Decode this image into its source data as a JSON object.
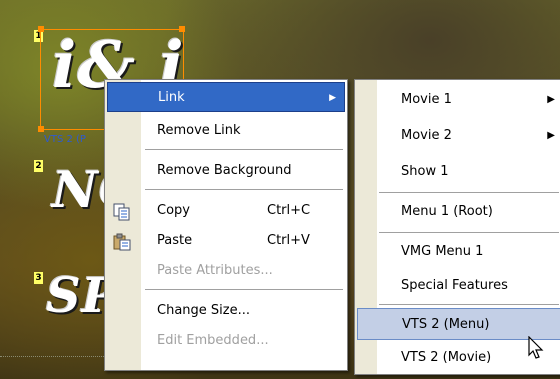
{
  "canvas": {
    "items": [
      {
        "num": "1",
        "text": "i& i"
      },
      {
        "num": "2",
        "text": "NO"
      },
      {
        "num": "3",
        "text": "SP"
      }
    ],
    "selected_label": "VTS 2 (P"
  },
  "context_menu": {
    "items": [
      {
        "label": "Link",
        "has_submenu": true,
        "state": "highlighted"
      },
      {
        "label": "Remove Link",
        "state": "enabled"
      },
      {
        "label": "Remove Background",
        "state": "enabled"
      },
      {
        "label": "Copy",
        "shortcut": "Ctrl+C",
        "icon": "copy-icon",
        "state": "enabled"
      },
      {
        "label": "Paste",
        "shortcut": "Ctrl+V",
        "icon": "paste-icon",
        "state": "enabled"
      },
      {
        "label": "Paste Attributes...",
        "state": "disabled"
      },
      {
        "label": "Change Size...",
        "state": "enabled"
      },
      {
        "label": "Edit Embedded...",
        "state": "disabled"
      }
    ]
  },
  "submenu": {
    "items": [
      {
        "label": "Movie 1",
        "has_submenu": true
      },
      {
        "label": "Movie 2",
        "has_submenu": true
      },
      {
        "label": "Show 1"
      },
      {
        "label": "Menu 1 (Root)"
      },
      {
        "label": "VMG Menu 1"
      },
      {
        "label": "Special Features"
      },
      {
        "label": "VTS 2 (Menu)",
        "state": "hovered"
      },
      {
        "label": "VTS 2 (Movie)"
      }
    ]
  },
  "colors": {
    "highlight": "#3169c6",
    "hover": "#c3cfe6",
    "selection": "#ff8c00",
    "item_number_bg": "#ffff66",
    "gutter": "#ece9d8"
  }
}
